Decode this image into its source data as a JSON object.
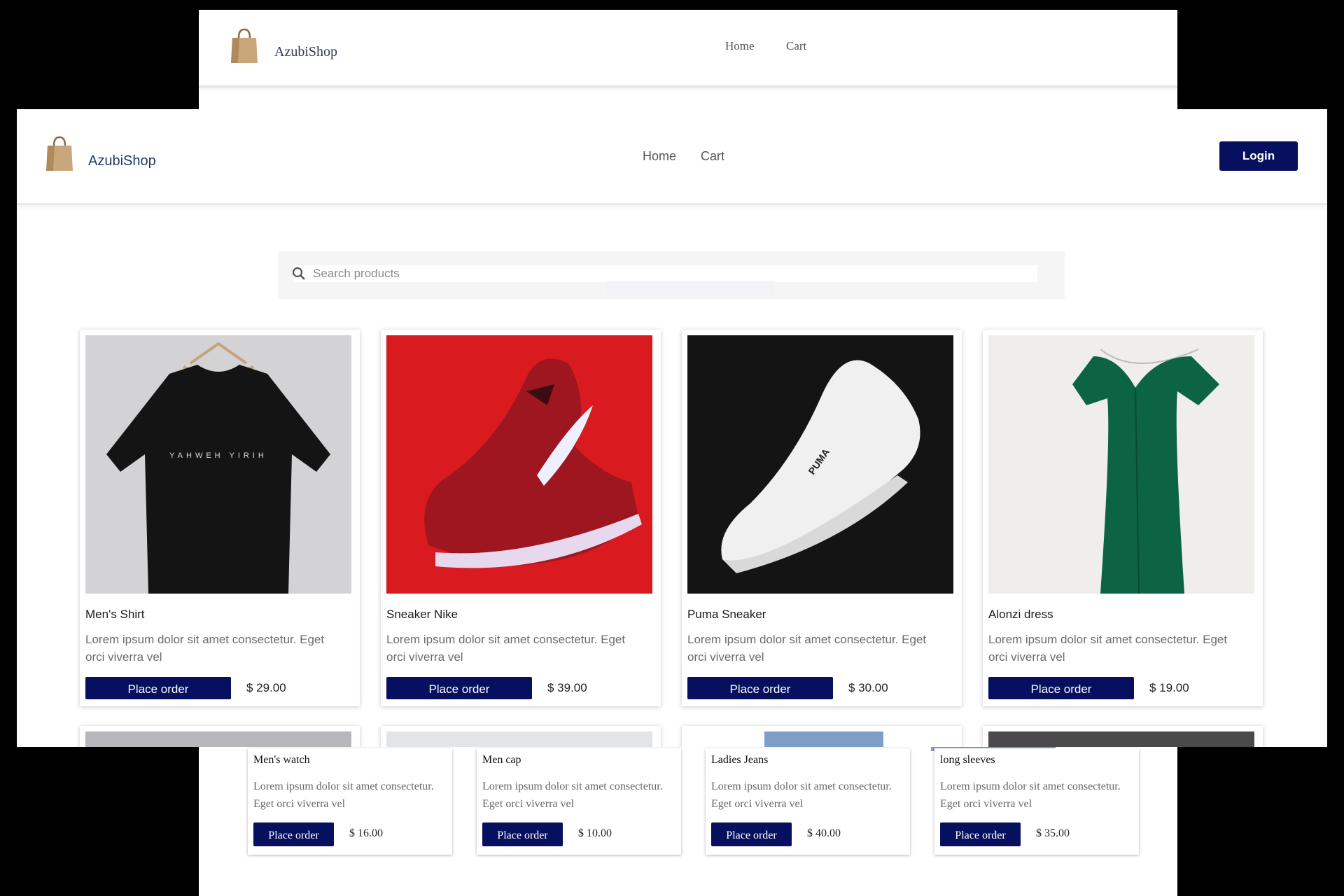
{
  "app": {
    "brand": "AzubiShop",
    "accent": "#06105f"
  },
  "nav": {
    "home": "Home",
    "cart": "Cart",
    "login": "Login"
  },
  "search": {
    "placeholder": "Search products"
  },
  "products": [
    {
      "name": "Men's Shirt",
      "desc": "Lorem ipsum dolor sit amet consectetur. Eget orci viverra vel",
      "price": "$ 29.00",
      "button": "Place order",
      "image": "black t-shirt on hanger"
    },
    {
      "name": "Sneaker Nike",
      "desc": "Lorem ipsum dolor sit amet consectetur. Eget orci viverra vel",
      "price": "$ 39.00",
      "button": "Place order",
      "image": "red nike sneaker"
    },
    {
      "name": "Puma Sneaker",
      "desc": "Lorem ipsum dolor sit amet consectetur. Eget orci viverra vel",
      "price": "$ 30.00",
      "button": "Place order",
      "image": "white puma sneaker"
    },
    {
      "name": "Alonzi dress",
      "desc": "Lorem ipsum dolor sit amet consectetur. Eget orci viverra vel",
      "price": "$ 19.00",
      "button": "Place order",
      "image": "green dress on hanger"
    }
  ],
  "back_products": [
    {
      "name": "Men's watch",
      "desc": "Lorem ipsum dolor sit amet consectetur. Eget orci viverra vel",
      "price": "$ 16.00",
      "button": "Place order"
    },
    {
      "name": "Men cap",
      "desc": "Lorem ipsum dolor sit amet consectetur. Eget orci viverra vel",
      "price": "$ 10.00",
      "button": "Place order"
    },
    {
      "name": "Ladies Jeans",
      "desc": "Lorem ipsum dolor sit amet consectetur. Eget orci viverra vel",
      "price": "$ 40.00",
      "button": "Place order"
    },
    {
      "name": "long sleeves",
      "desc": "Lorem ipsum dolor sit amet consectetur. Eget orci viverra vel",
      "price": "$ 35.00",
      "button": "Place order"
    }
  ]
}
